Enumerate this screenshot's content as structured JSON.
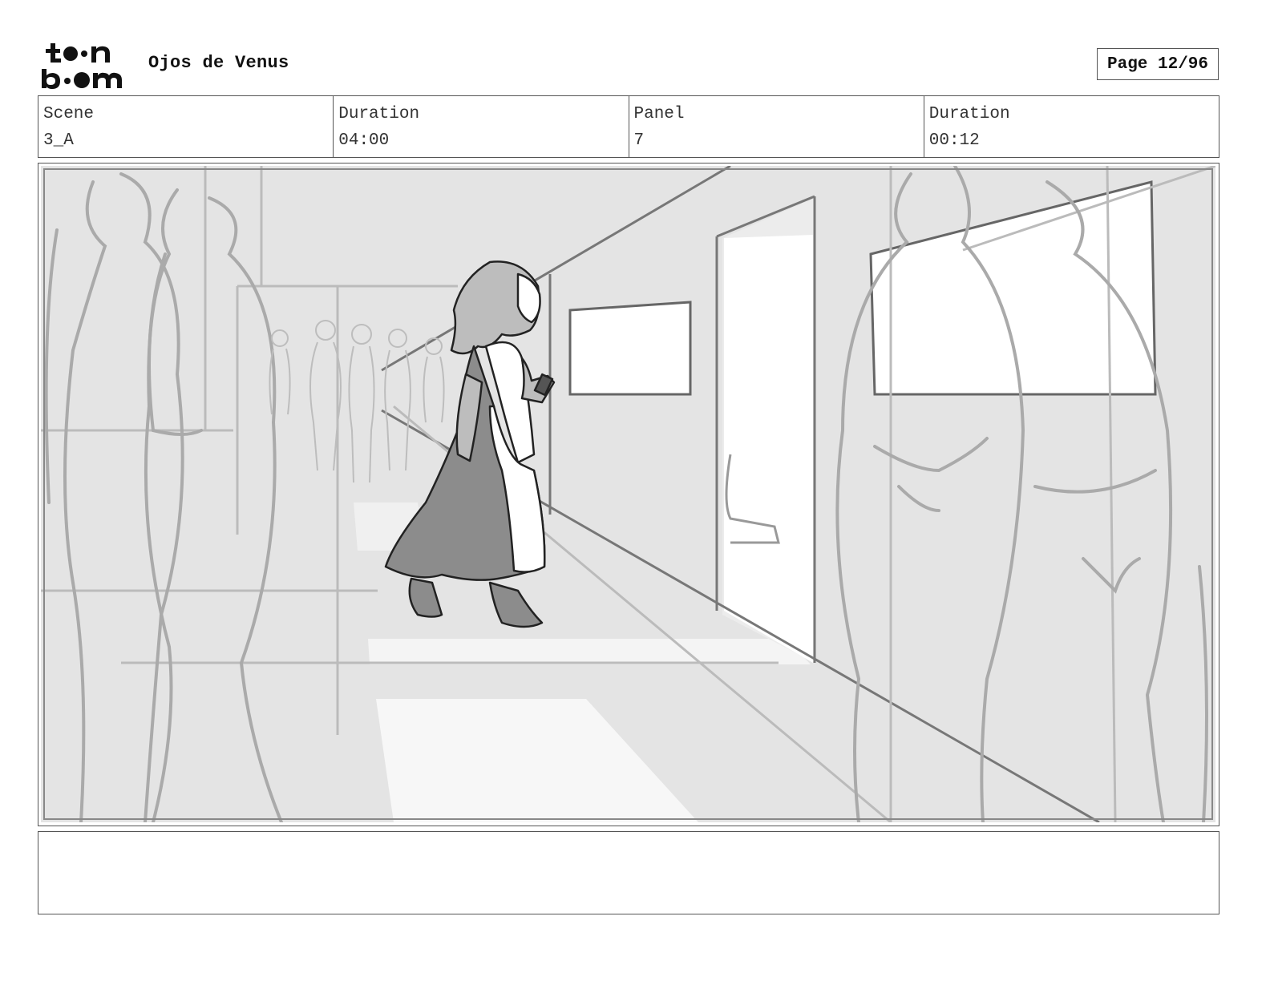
{
  "header": {
    "logo_text": "toonboom",
    "project_title": "Ojos de Venus",
    "page_label": "Page 12/96"
  },
  "info": {
    "scene_label": "Scene",
    "scene_value": "3_A",
    "scene_duration_label": "Duration",
    "scene_duration_value": "04:00",
    "panel_label": "Panel",
    "panel_value": "7",
    "panel_duration_label": "Duration",
    "panel_duration_value": "00:12"
  },
  "notes": {
    "text": ""
  }
}
